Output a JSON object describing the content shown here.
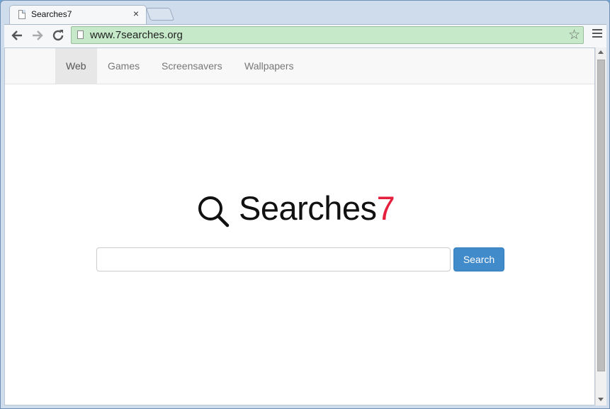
{
  "browser": {
    "tab_title": "Searches7",
    "tab_close": "×",
    "url": "www.7searches.org"
  },
  "site": {
    "nav": [
      {
        "label": "Web",
        "active": true
      },
      {
        "label": "Games",
        "active": false
      },
      {
        "label": "Screensavers",
        "active": false
      },
      {
        "label": "Wallpapers",
        "active": false
      }
    ],
    "brand_text": "Searches",
    "brand_number": "7",
    "brand_color": "#e5203f",
    "search": {
      "value": "",
      "button_label": "Search"
    }
  },
  "icons": [
    "document-icon",
    "close-icon",
    "back-icon",
    "forward-icon",
    "reload-icon",
    "star-icon",
    "menu-icon",
    "search-icon"
  ],
  "colors": {
    "accent": "#428bca",
    "omnibox": "#c6eac9"
  }
}
